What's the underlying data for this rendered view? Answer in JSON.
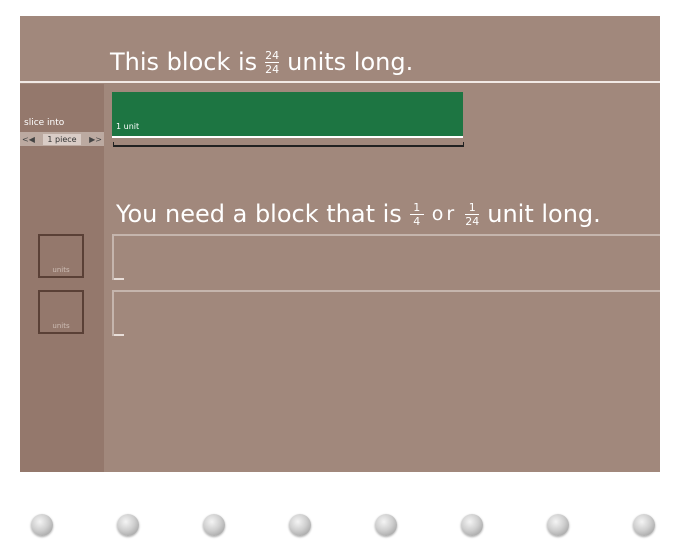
{
  "header": {
    "prefix": "This block is",
    "fraction": {
      "numerator": "24",
      "denominator": "24"
    },
    "suffix": "units long."
  },
  "block": {
    "label": "1 unit",
    "color": "#1d7542"
  },
  "slicer": {
    "label": "slice into",
    "value": "1 piece"
  },
  "prompt": {
    "prefix": "You need a block that is",
    "fraction_a": {
      "numerator": "1",
      "denominator": "4"
    },
    "connector": "or",
    "fraction_b": {
      "numerator": "1",
      "denominator": "24"
    },
    "suffix": "unit long."
  },
  "unit_boxes": [
    {
      "label": "units"
    },
    {
      "label": "units"
    }
  ],
  "nav_dots": {
    "count": 8
  },
  "colors": {
    "background": "#a1887c",
    "sidebar": "#94786c",
    "block": "#1d7542"
  }
}
